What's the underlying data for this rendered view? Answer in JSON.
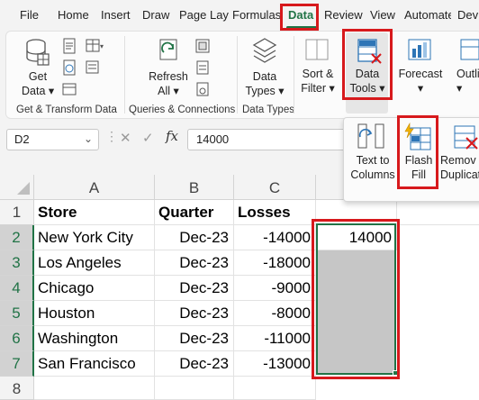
{
  "tabs": [
    "File",
    "Home",
    "Insert",
    "Draw",
    "Page Lay",
    "Formulas",
    "Data",
    "Review",
    "View",
    "Automate",
    "Dev"
  ],
  "active_tab": "Data",
  "ribbon": {
    "get_data": [
      "Get",
      "Data"
    ],
    "refresh_all": [
      "Refresh",
      "All"
    ],
    "data_types": [
      "Data",
      "Types"
    ],
    "sort_filter": [
      "Sort &",
      "Filter"
    ],
    "data_tools": [
      "Data",
      "Tools"
    ],
    "forecast": "Forecast",
    "outline": "Outli",
    "groups": [
      "Get & Transform Data",
      "Queries & Connections",
      "Data Types"
    ]
  },
  "dropdown": {
    "text_to_columns": [
      "Text to",
      "Columns"
    ],
    "flash_fill": [
      "Flash",
      "Fill"
    ],
    "remove_duplicates": [
      "Remov",
      "Duplicat"
    ]
  },
  "formula_bar": {
    "name_box": "D2",
    "fx": "fx",
    "formula": "14000"
  },
  "columns": [
    "A",
    "B",
    "C"
  ],
  "rows": [
    "1",
    "2",
    "3",
    "4",
    "5",
    "6",
    "7",
    "8"
  ],
  "headers": [
    "Store",
    "Quarter",
    "Losses"
  ],
  "data": [
    [
      "New York City",
      "Dec-23",
      "-14000"
    ],
    [
      "Los Angeles",
      "Dec-23",
      "-18000"
    ],
    [
      "Chicago",
      "Dec-23",
      "-9000"
    ],
    [
      "Houston",
      "Dec-23",
      "-8000"
    ],
    [
      "Washington",
      "Dec-23",
      "-11000"
    ],
    [
      "San Francisco",
      "Dec-23",
      "-13000"
    ]
  ],
  "d2_value": "14000",
  "colors": {
    "accent": "#217346",
    "highlight": "#d7191c",
    "selection": "#c6c6c6"
  }
}
